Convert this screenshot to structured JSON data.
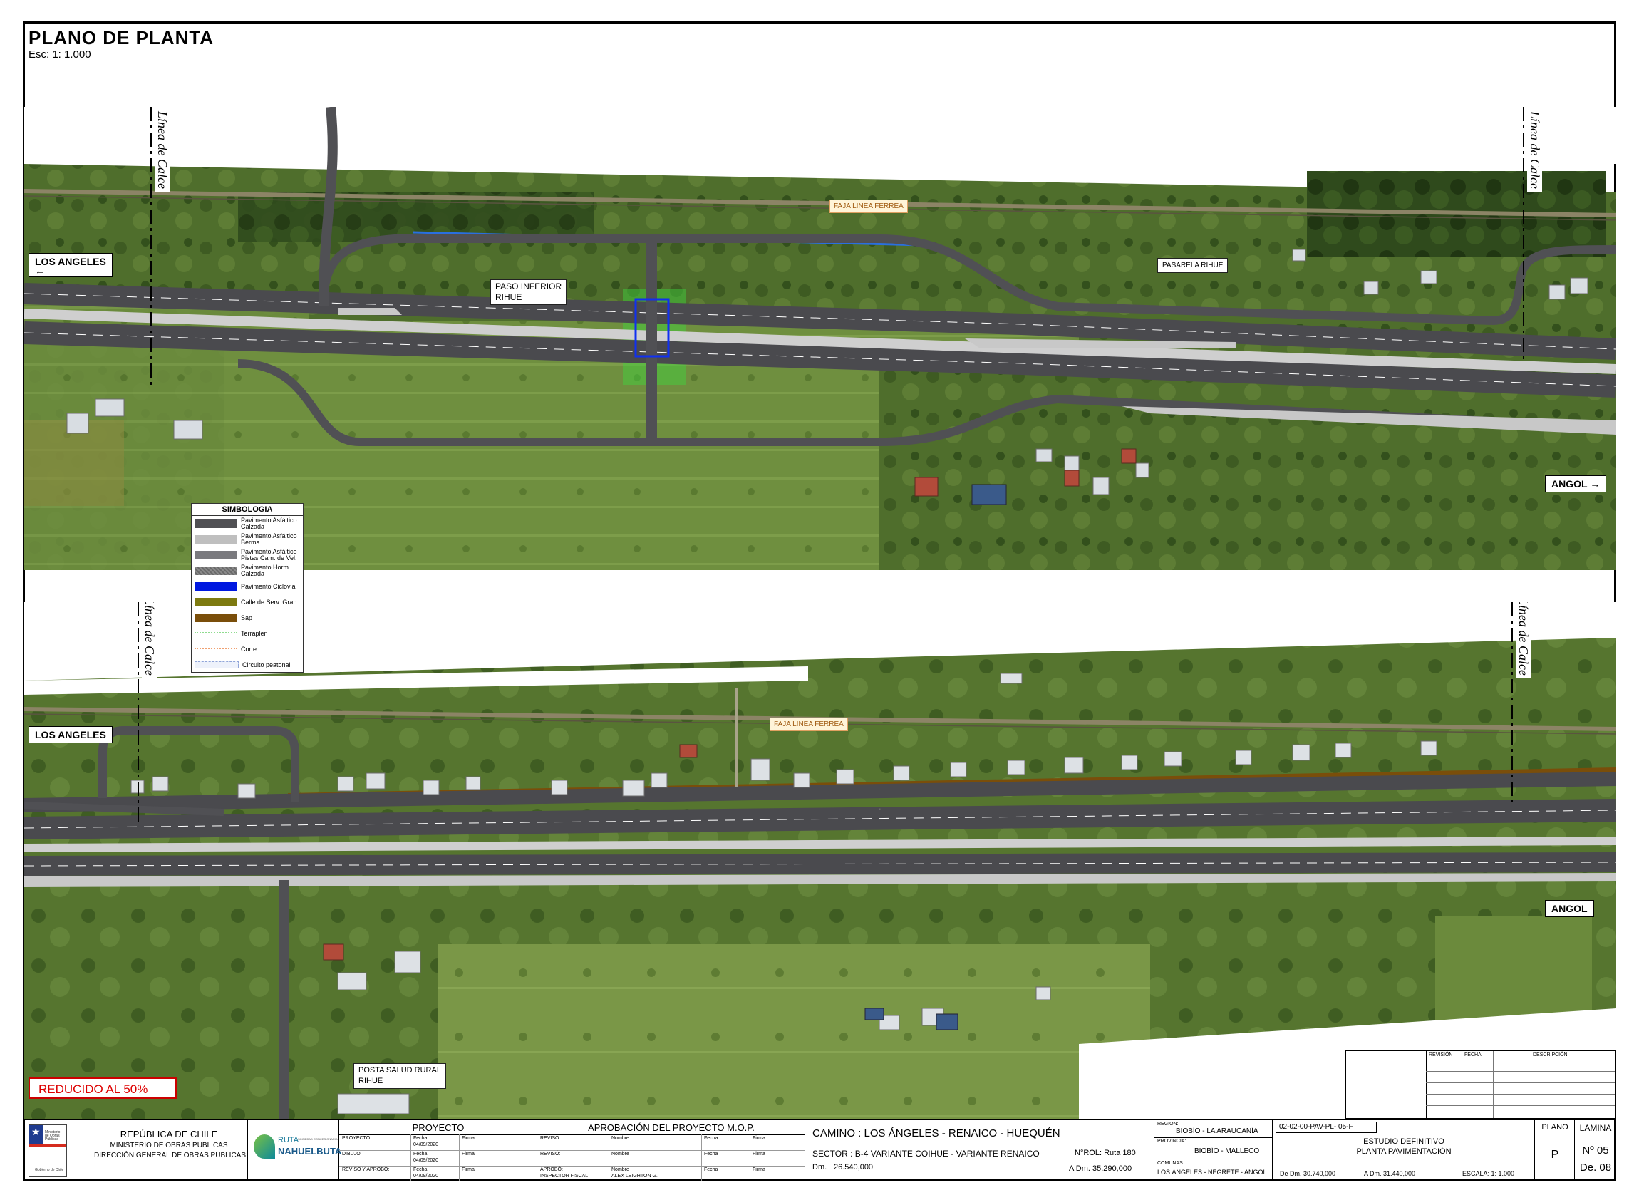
{
  "header": {
    "title": "PLANO DE PLANTA",
    "scale": "Esc: 1: 1.000"
  },
  "labels": {
    "los_angeles": "LOS ANGELES",
    "angol": "ANGOL",
    "linea_calce": "Línea de Calce",
    "faja_linea_ferrea": "FAJA LINEA FERREA",
    "paso_inferior": "PASO INFERIOR",
    "rihue": "RIHUE",
    "pasarela_rihue": "PASARELA RIHUE",
    "posta_salud": "POSTA SALUD RURAL",
    "reducido": "REDUCIDO AL 50%"
  },
  "legend": {
    "title": "SIMBOLOGIA",
    "items": [
      {
        "label_1": "Pavimento Asfáltico",
        "label_2": "Calzada",
        "color": "#505054"
      },
      {
        "label_1": "Pavimento Asfáltico",
        "label_2": "Berma",
        "color": "#bfbfbf"
      },
      {
        "label_1": "Pavimento Asfáltico",
        "label_2": "Pistas Cam. de Vel.",
        "color": "#7a7a7e"
      },
      {
        "label_1": "Pavimento Horm.",
        "label_2": "Calzada",
        "color": "#8a8a8a"
      },
      {
        "label_1": "Pavimento Ciclovia",
        "label_2": "",
        "color": "#0018e0"
      },
      {
        "label_1": "Calle de Serv. Gran.",
        "label_2": "",
        "color": "#7d7a10"
      },
      {
        "label_1": "Sap",
        "label_2": "",
        "color": "#7a4e0a"
      },
      {
        "label_1": "Terraplen",
        "label_2": "",
        "color": "#8fdc8f"
      },
      {
        "label_1": "Corte",
        "label_2": "",
        "color": "#f0a070"
      },
      {
        "label_1": "Circuito peatonal",
        "label_2": "",
        "color": "#c8d4f0"
      }
    ]
  },
  "revision": {
    "col_1": "REVISIÓN",
    "col_2": "FECHA",
    "col_3": "DESCRIPCIÓN"
  },
  "title_block": {
    "republica": "REPÚBLICA DE CHILE",
    "ministerio": "MINISTERIO DE OBRAS PUBLICAS",
    "direccion": "DIRECCIÓN GENERAL DE OBRAS PUBLICAS",
    "mop_logo_text": "Ministerio de Obras Públicas",
    "mop_logo_bottom": "Gobierno de Chile",
    "ruta": "RUTA",
    "nahuelbuta": "NAHUELBUTA",
    "ruta_small": "SOCIEDAD CONCESIONARIA",
    "proyecto": "PROYECTO",
    "aprobacion": "APROBACIÓN DEL PROYECTO M.O.P.",
    "proyecto_rows": [
      {
        "role": "PROYECTO:",
        "fecha_lbl": "Fecha",
        "fecha": "",
        "firma": "Firma"
      },
      {
        "role": "DIBUJO:",
        "fecha_lbl": "Fecha",
        "fecha": "04/09/2020",
        "firma": "Firma"
      },
      {
        "role": "REVISO Y APROBO:",
        "fecha_lbl": "Fecha",
        "fecha": "04/09/2020",
        "firma": "Firma"
      }
    ],
    "proyecto_fecha_first": "04/09/2020",
    "aprob_rows": [
      {
        "role": "REVISÓ:",
        "nombre": "Nombre",
        "fecha": "Fecha",
        "firma": "Firma"
      },
      {
        "role": "REVISÓ:",
        "nombre": "Nombre",
        "fecha": "Fecha",
        "firma": "Firma"
      },
      {
        "role": "APROBÓ:",
        "nombre": "Nombre",
        "fecha": "Fecha",
        "firma": "Firma"
      }
    ],
    "inspector": "INSPECTOR FISCAL",
    "inspector_name": "ALEX LEIGHTON G.",
    "camino": "CAMINO : LOS ÁNGELES - RENAICO - HUEQUÉN",
    "sector": "SECTOR : B-4 VARIANTE COIHUE - VARIANTE RENAICO",
    "rol": "N°ROL: Ruta 180",
    "dm_lbl": "Dm.",
    "dm": "26.540,000",
    "adm": "A Dm.   35.290,000",
    "region_lbl": "REGION:",
    "region": "BIOBÍO - LA ARAUCANÍA",
    "provincia_lbl": "PROVINCIA:",
    "provincia": "BIOBÍO - MALLECO",
    "comunas_lbl": "COMUNAS:",
    "comunas": "LOS ÁNGELES - NEGRETE - ANGOL",
    "codigo": "02-02-00-PAV-PL- 05-F",
    "estudio": "ESTUDIO DEFINITIVO",
    "planta": "PLANTA PAVIMENTACIÓN",
    "de_dm": "De Dm. 30.740,000",
    "a_dm": "A Dm. 31.440,000",
    "escala": "ESCALA:  1: 1.000",
    "plano_lbl": "PLANO",
    "plano": "P",
    "lamina_lbl": "LAMINA",
    "numero": "Nº  05",
    "de": "De. 08"
  }
}
